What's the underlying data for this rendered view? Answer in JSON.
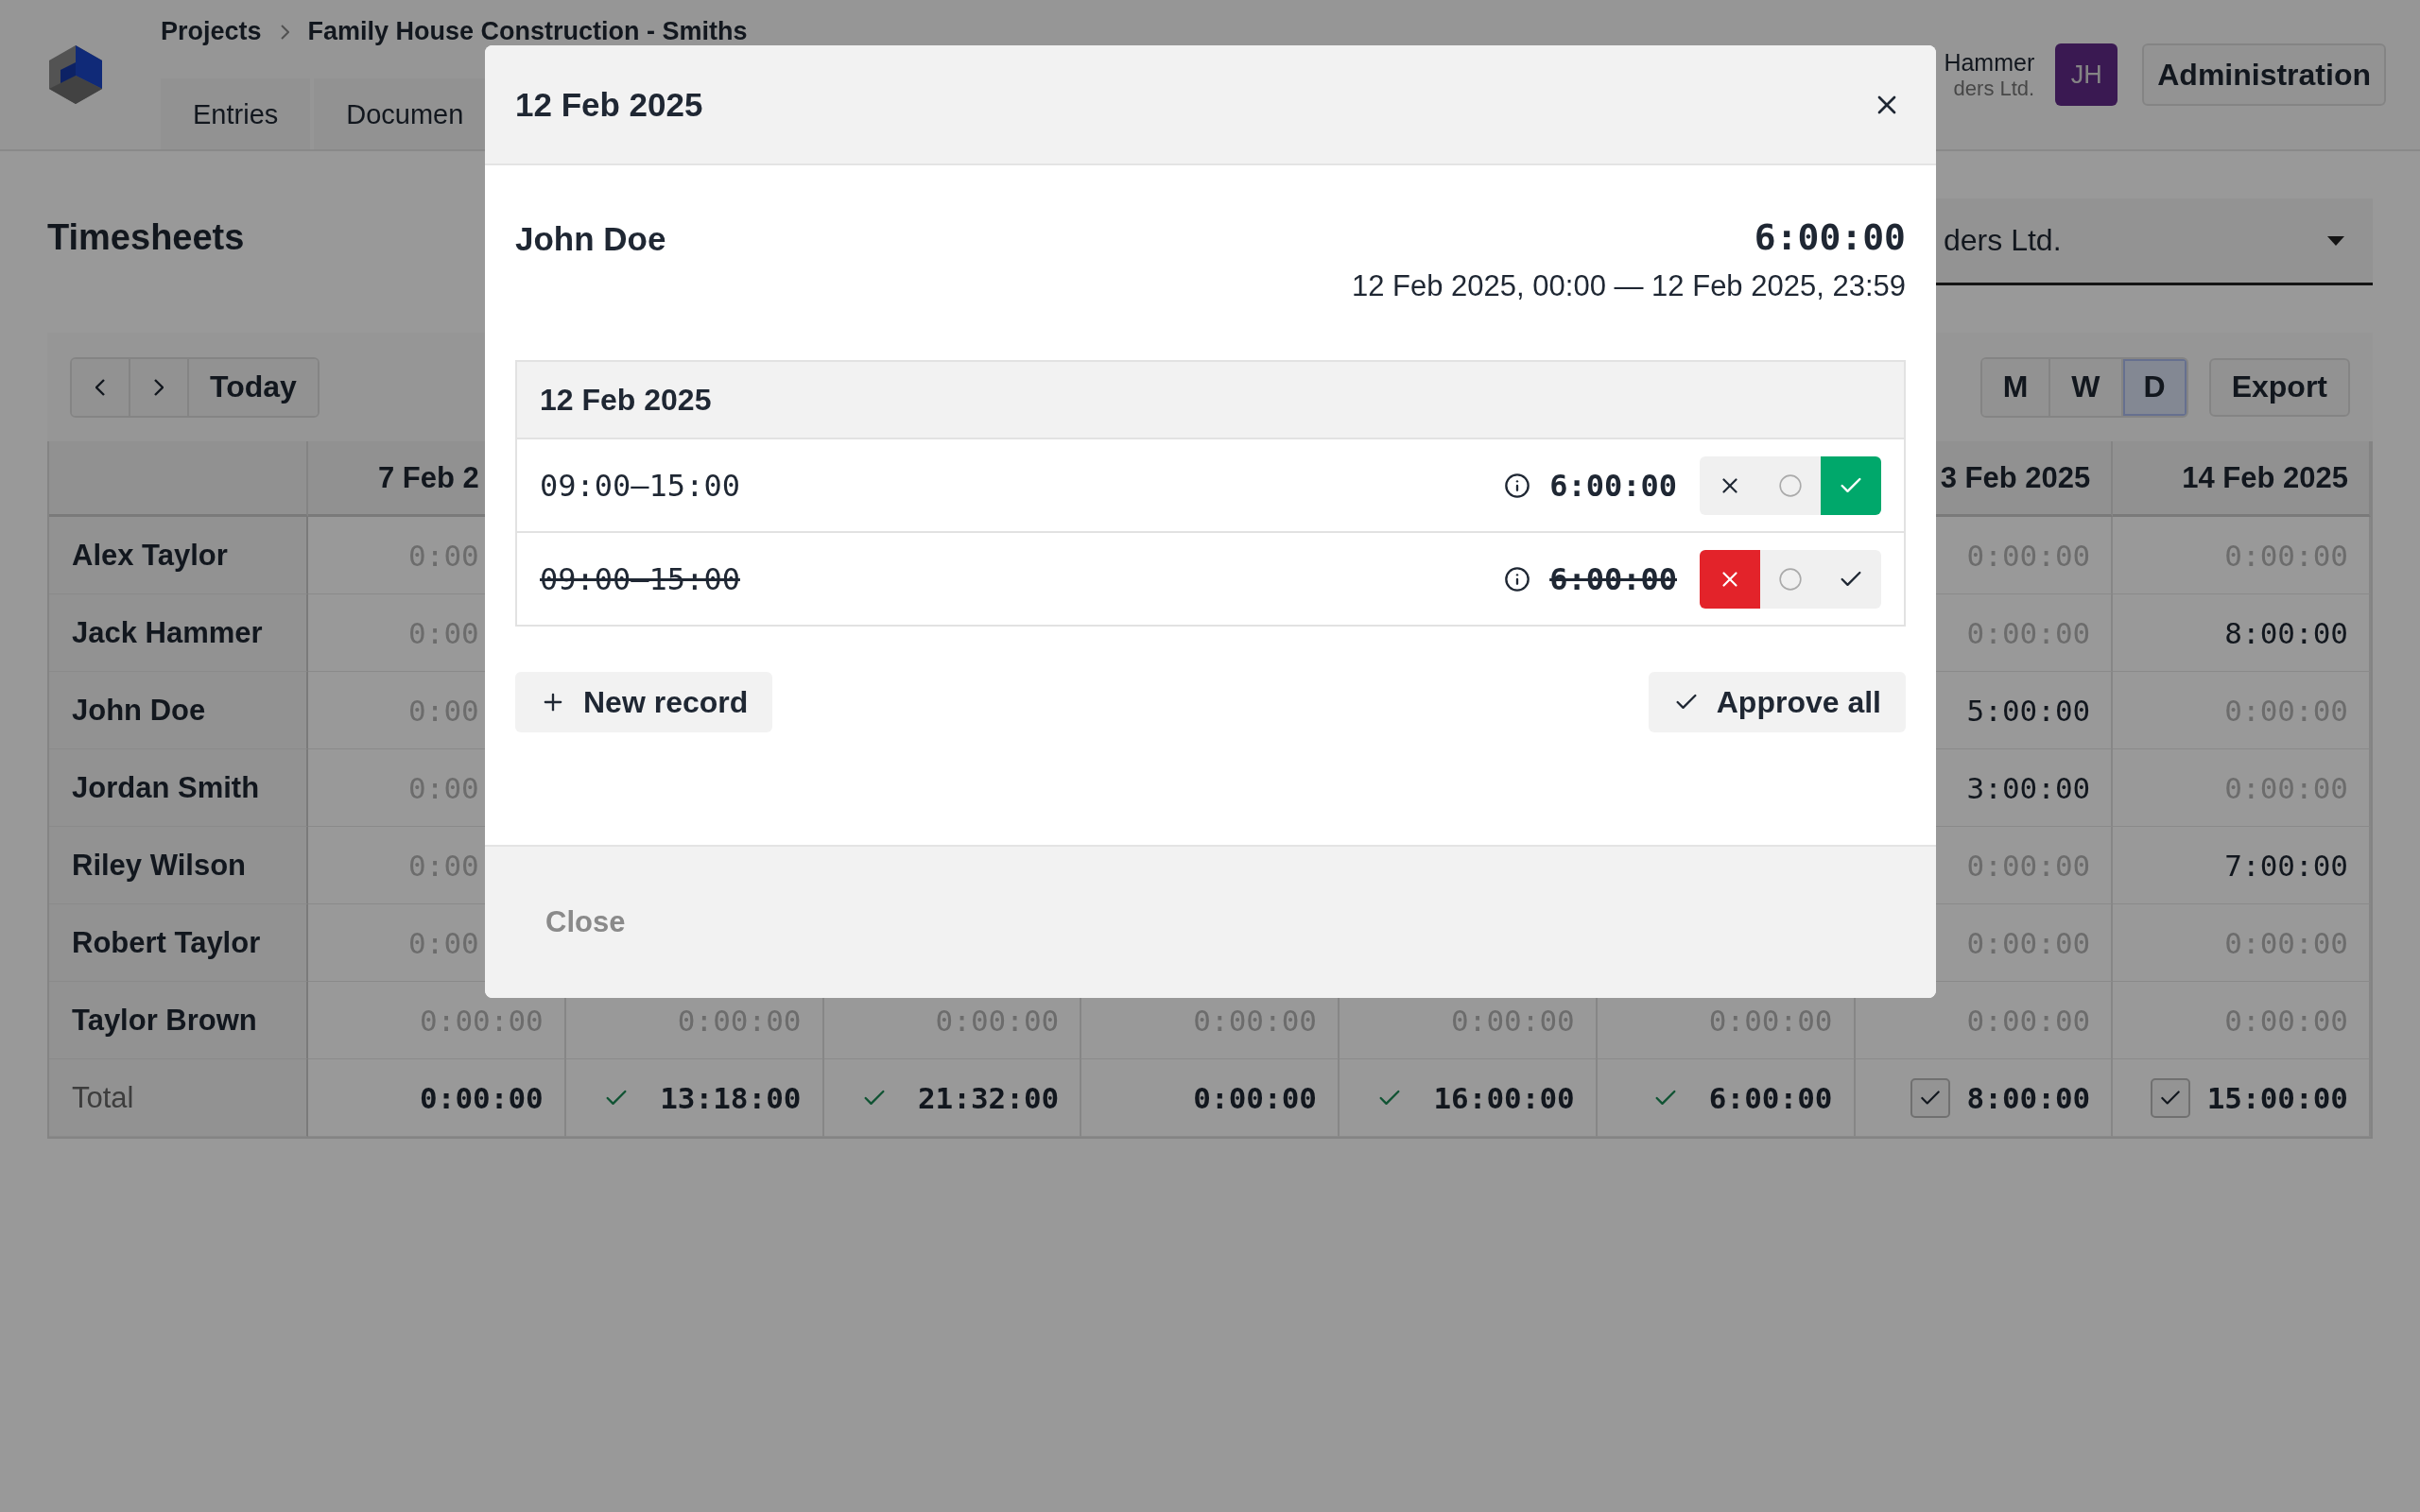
{
  "header": {
    "breadcrumb": [
      "Projects",
      "Family House Construction - Smiths"
    ],
    "tabs": [
      {
        "label": "Entries"
      },
      {
        "label": "Documen"
      }
    ],
    "user": {
      "name": "Hammer",
      "company": "ders Ltd.",
      "initials": "JH"
    },
    "admin_button": "Administration"
  },
  "page": {
    "title": "Timesheets",
    "company_select": {
      "value": "ders Ltd."
    }
  },
  "toolbar": {
    "today": "Today",
    "views": [
      {
        "label": "M",
        "selected": false
      },
      {
        "label": "W",
        "selected": false
      },
      {
        "label": "D",
        "selected": true
      }
    ],
    "export": "Export"
  },
  "table": {
    "columns": [
      "7 Feb 2",
      null,
      null,
      null,
      null,
      null,
      "3 Feb 2025",
      "14 Feb 2025"
    ],
    "rows": [
      {
        "name": "Alex Taylor",
        "cells": [
          {
            "value": "0:00",
            "zero": true
          },
          null,
          null,
          null,
          null,
          null,
          {
            "value": "0:00:00",
            "zero": true
          },
          {
            "value": "0:00:00",
            "zero": true
          }
        ]
      },
      {
        "name": "Jack Hammer",
        "cells": [
          {
            "value": "0:00",
            "zero": true
          },
          null,
          null,
          null,
          null,
          null,
          {
            "value": "0:00:00",
            "zero": true
          },
          {
            "value": "8:00:00",
            "zero": false
          }
        ]
      },
      {
        "name": "John Doe",
        "cells": [
          {
            "value": "0:00",
            "zero": true
          },
          null,
          null,
          null,
          null,
          null,
          {
            "value": "5:00:00",
            "zero": false
          },
          {
            "value": "0:00:00",
            "zero": true
          }
        ]
      },
      {
        "name": "Jordan Smith",
        "cells": [
          {
            "value": "0:00",
            "zero": true
          },
          null,
          null,
          null,
          null,
          null,
          {
            "value": "3:00:00",
            "zero": false
          },
          {
            "value": "0:00:00",
            "zero": true
          }
        ]
      },
      {
        "name": "Riley Wilson",
        "cells": [
          {
            "value": "0:00",
            "zero": true
          },
          null,
          null,
          null,
          null,
          null,
          {
            "value": "0:00:00",
            "zero": true
          },
          {
            "value": "7:00:00",
            "zero": false
          }
        ]
      },
      {
        "name": "Robert Taylor",
        "cells": [
          {
            "value": "0:00",
            "zero": true
          },
          null,
          null,
          null,
          null,
          null,
          {
            "value": "0:00:00",
            "zero": true
          },
          {
            "value": "0:00:00",
            "zero": true
          }
        ]
      },
      {
        "name": "Taylor Brown",
        "cells": [
          {
            "value": "0:00:00",
            "zero": true
          },
          {
            "value": "0:00:00",
            "zero": true
          },
          {
            "value": "0:00:00",
            "zero": true
          },
          {
            "value": "0:00:00",
            "zero": true
          },
          {
            "value": "0:00:00",
            "zero": true
          },
          {
            "value": "0:00:00",
            "zero": true
          },
          {
            "value": "0:00:00",
            "zero": true
          },
          {
            "value": "0:00:00",
            "zero": true
          }
        ]
      }
    ],
    "total": {
      "label": "Total",
      "cells": [
        {
          "value": "0:00:00",
          "kind": "plain"
        },
        {
          "value": "13:18:00",
          "kind": "approved"
        },
        {
          "value": "21:32:00",
          "kind": "approved"
        },
        {
          "value": "0:00:00",
          "kind": "plain"
        },
        {
          "value": "16:00:00",
          "kind": "approved"
        },
        {
          "value": "6:00:00",
          "kind": "approved"
        },
        {
          "value": "8:00:00",
          "kind": "checkbox",
          "checked": true
        },
        {
          "value": "15:00:00",
          "kind": "checkbox",
          "checked": true
        }
      ]
    }
  },
  "modal": {
    "title": "12 Feb 2025",
    "person": "John Doe",
    "total": "6:00:00",
    "range": "12 Feb 2025, 00:00 — 12 Feb 2025, 23:59",
    "day": "12 Feb 2025",
    "records": [
      {
        "time": "09:00–15:00",
        "duration": "6:00:00",
        "actions": [
          {
            "kind": "reject",
            "selected": false
          },
          {
            "kind": "pending",
            "selected": false
          },
          {
            "kind": "approve",
            "selected": true
          }
        ]
      },
      {
        "time": "09:00–15:00",
        "duration": "6:00:00",
        "actions": [
          {
            "kind": "reject",
            "selected": true
          },
          {
            "kind": "pending",
            "selected": false
          },
          {
            "kind": "approve",
            "selected": false
          }
        ]
      }
    ],
    "new_record": "New record",
    "approve_all": "Approve all",
    "close": "Close"
  }
}
